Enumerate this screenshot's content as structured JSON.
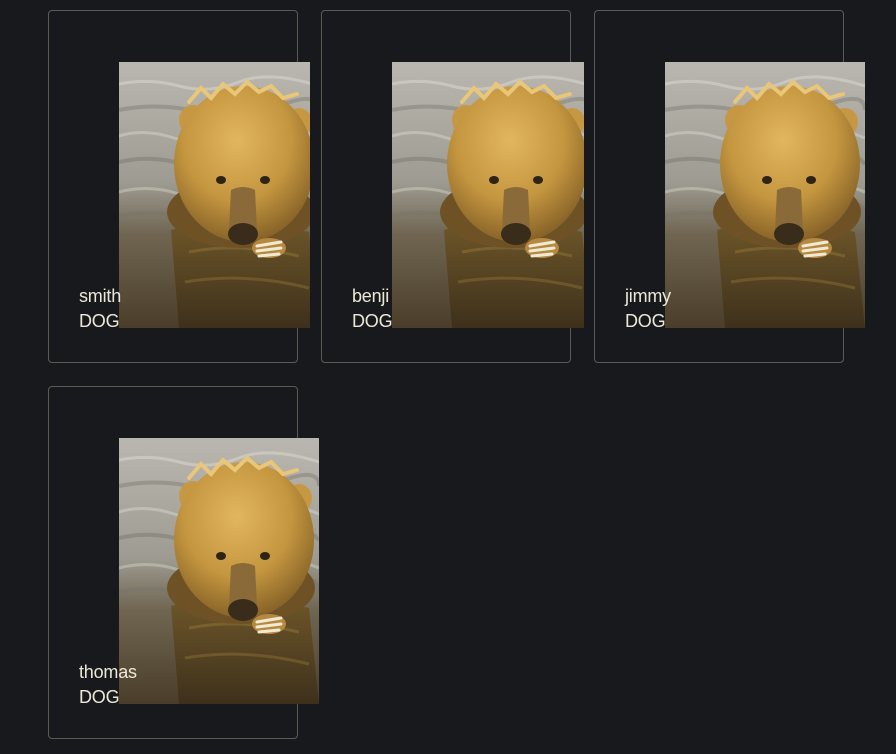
{
  "cards": [
    {
      "name": "smith",
      "type": "DOG",
      "image": "brown-bear-in-water"
    },
    {
      "name": "benji",
      "type": "DOG",
      "image": "brown-bear-in-water"
    },
    {
      "name": "jimmy",
      "type": "DOG",
      "image": "brown-bear-in-water"
    },
    {
      "name": "thomas",
      "type": "DOG",
      "image": "brown-bear-in-water"
    }
  ],
  "colors": {
    "background": "#18191c",
    "card_border": "#5b5a55",
    "label_text": "#ece8d8"
  }
}
